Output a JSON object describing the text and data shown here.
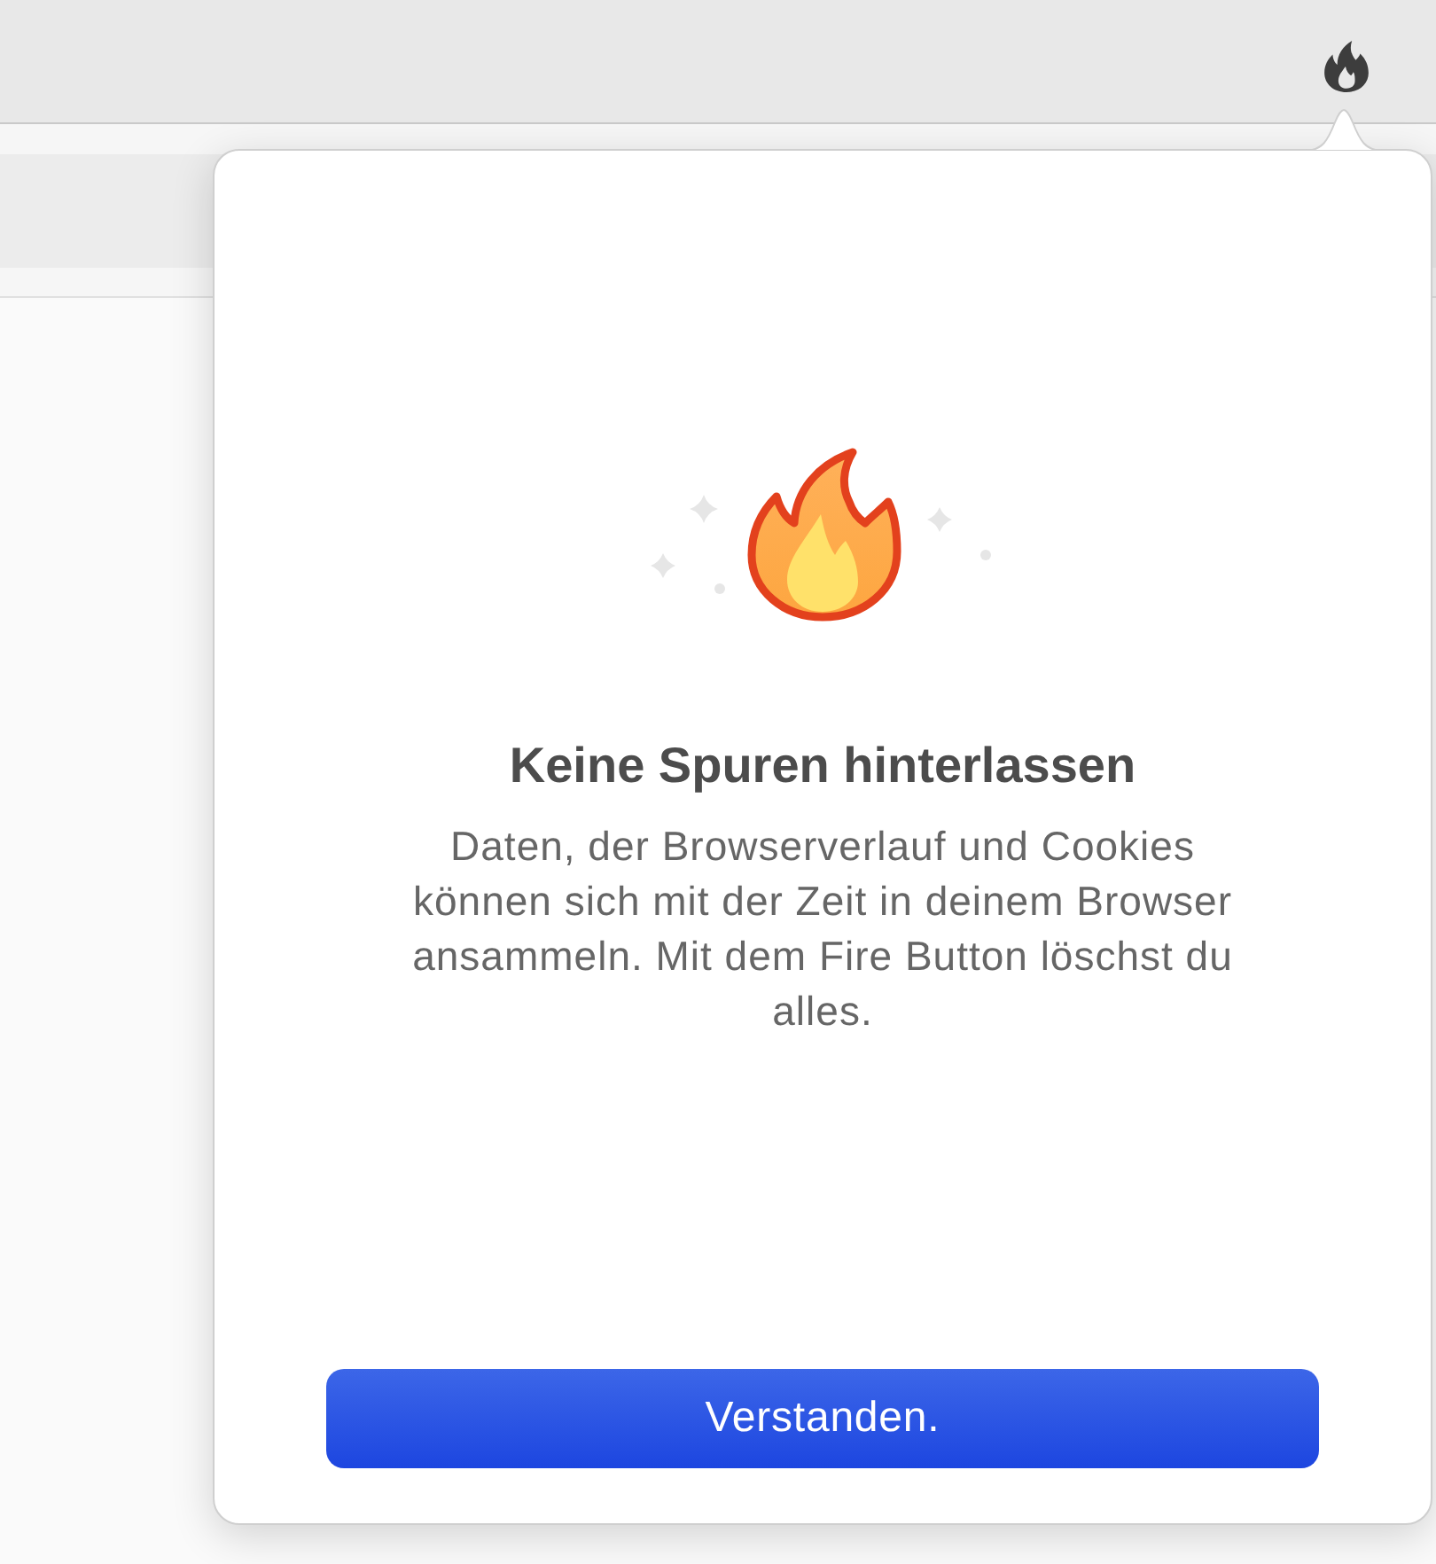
{
  "popover": {
    "title": "Keine Spuren hinterlassen",
    "message": "Daten, der Browserverlauf und Cookies können sich mit der Zeit in deinem Browser ansammeln. Mit dem Fire Button löschst du alles.",
    "button": "Verstanden."
  }
}
